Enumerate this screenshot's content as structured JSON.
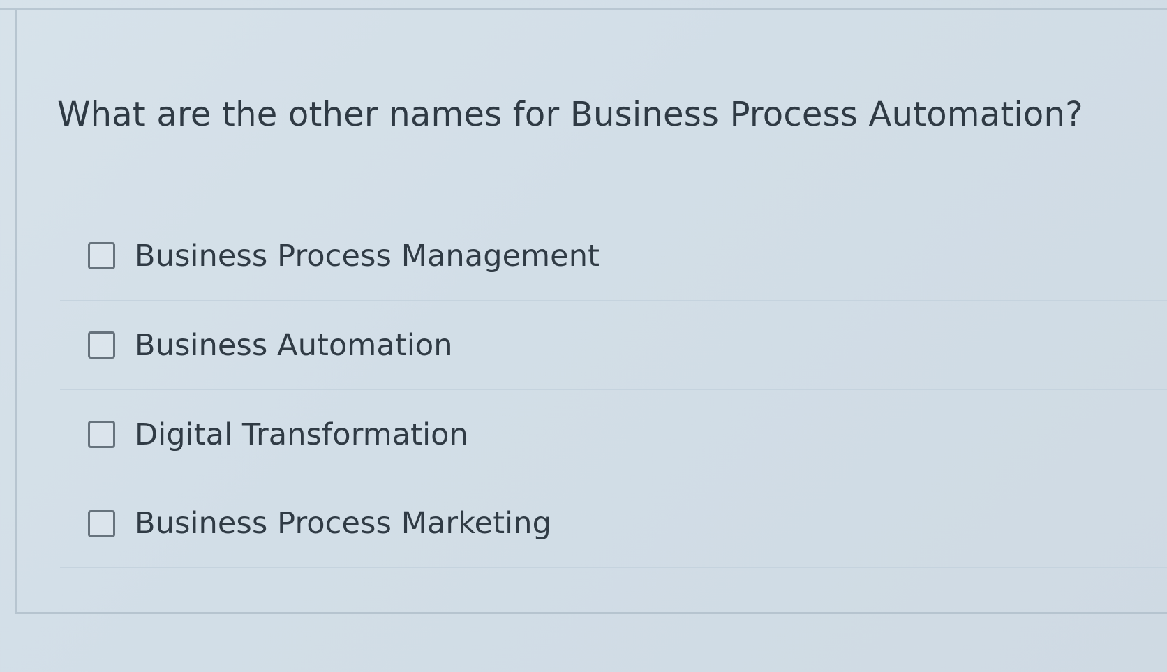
{
  "question": {
    "text": "What are the other names for Business Process Automation?"
  },
  "options": [
    {
      "label": "Business Process Management",
      "checked": false
    },
    {
      "label": "Business Automation",
      "checked": false
    },
    {
      "label": "Digital Transformation",
      "checked": false
    },
    {
      "label": "Business Process Marketing",
      "checked": false
    }
  ]
}
